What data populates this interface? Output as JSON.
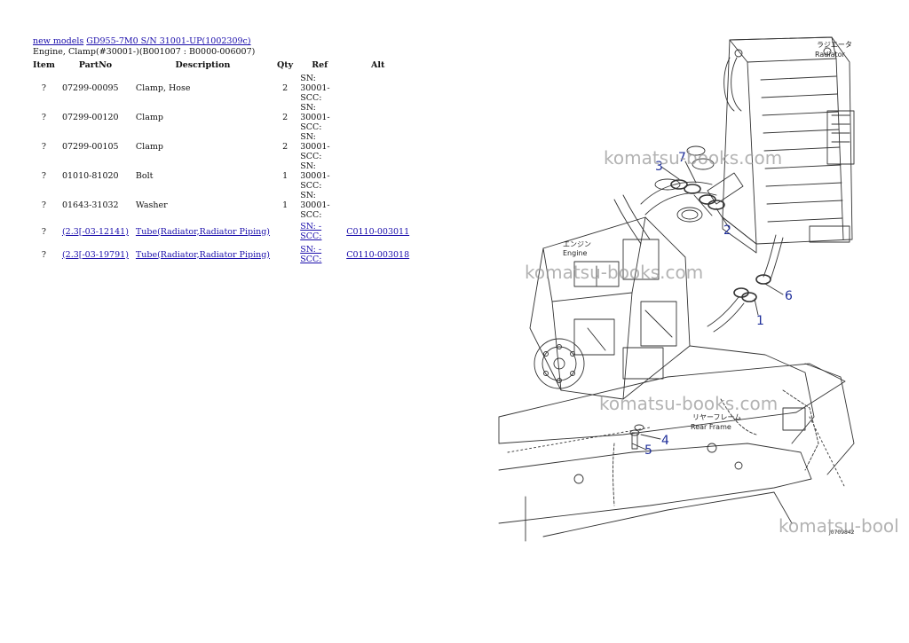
{
  "breadcrumb": {
    "link1": "new models",
    "link2": "GD955-7M0 S/N 31001-UP(1002309c)"
  },
  "subtitle": "Engine, Clamp(#30001-)(B001007 : B0000-006007)",
  "table": {
    "headers": {
      "item": "Item",
      "partno": "PartNo",
      "description": "Description",
      "qty": "Qty",
      "ref": "Ref",
      "alt": "Alt"
    },
    "rows": [
      {
        "item": "?",
        "partno": "07299-00095",
        "description": "Clamp, Hose",
        "qty": "2",
        "ref": "SN: 30001-SCC:",
        "alt": ""
      },
      {
        "item": "?",
        "partno": "07299-00120",
        "description": "Clamp",
        "qty": "2",
        "ref": "SN: 30001-SCC:",
        "alt": ""
      },
      {
        "item": "?",
        "partno": "07299-00105",
        "description": "Clamp",
        "qty": "2",
        "ref": "SN: 30001-SCC:",
        "alt": ""
      },
      {
        "item": "?",
        "partno": "01010-81020",
        "description": "Bolt",
        "qty": "1",
        "ref": "SN: 30001-SCC:",
        "alt": ""
      },
      {
        "item": "?",
        "partno": "01643-31032",
        "description": "Washer",
        "qty": "1",
        "ref": "SN: 30001-SCC:",
        "alt": ""
      },
      {
        "item": "?",
        "partno": "(2.3[-03-12141)",
        "description": "Tube(Radiator,Radiator Piping)",
        "qty": "",
        "ref": "SN: -SCC:",
        "alt": "C0110-003011"
      },
      {
        "item": "?",
        "partno": "(2.3[-03-19791)",
        "description": "Tube(Radiator,Radiator Piping)",
        "qty": "",
        "ref": "SN: -SCC:",
        "alt": "C0110-003018"
      }
    ]
  },
  "diagram": {
    "labels": {
      "radiator_jp": "ラジエータ",
      "radiator": "Radiator",
      "engine_jp": "エンジン",
      "engine": "Engine",
      "rear_frame_jp": "リヤーフレーム",
      "rear_frame": "Rear Frame",
      "drawing_no": "J0709842"
    },
    "callouts": [
      "1",
      "2",
      "3",
      "4",
      "5",
      "6",
      "7"
    ],
    "line_color": "#333333",
    "callout_color": "#1f2f9a"
  },
  "watermarks": [
    "komatsu-books.com",
    "komatsu-books.com",
    "komatsu-books.com",
    "komatsu-bool"
  ]
}
